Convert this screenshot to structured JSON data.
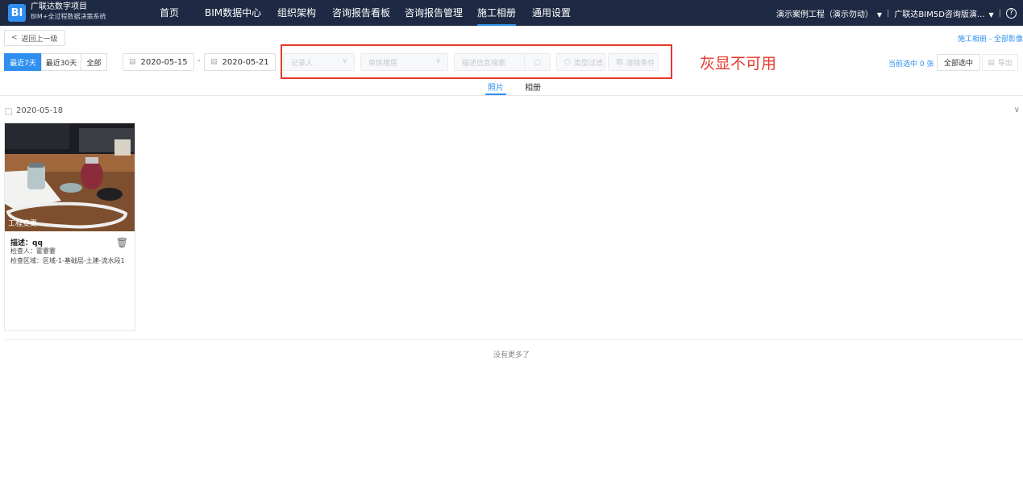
{
  "header": {
    "logo_text": "BI",
    "brand_line1": "广联达数字项目",
    "brand_line2": "BIM+全过程数据决策系统",
    "nav": [
      {
        "label": "首页",
        "active": false
      },
      {
        "label": "BIM数据中心",
        "active": false
      },
      {
        "label": "组织架构",
        "active": false
      },
      {
        "label": "咨询报告看板",
        "active": false
      },
      {
        "label": "咨询报告管理",
        "active": false
      },
      {
        "label": "施工相册",
        "active": true
      },
      {
        "label": "通用设置",
        "active": false
      }
    ],
    "project": "演示案例工程（演示勿动）",
    "org": "广联达BIM5D咨询版演...",
    "help": "?"
  },
  "toolbar": {
    "back_label": "返回上一级",
    "breadcrumb": "施工相册 - 全部影像",
    "ranges": [
      "最近7天",
      "最近30天",
      "全部"
    ],
    "date_start": "2020-05-15",
    "date_sep": "-",
    "date_end": "2020-05-21",
    "recorder_placeholder": "记录人",
    "floor_placeholder": "单体楼层",
    "search_placeholder": "描述信息搜索",
    "type_filter": "类型过滤",
    "clear_filter": "清除条件",
    "annotation": "灰显不可用",
    "selected_info": "当前选中 0 张",
    "select_all": "全部选中",
    "export": "导出"
  },
  "tabs": [
    {
      "label": "照片",
      "active": true
    },
    {
      "label": "相册",
      "active": false
    }
  ],
  "group": {
    "date": "2020-05-18",
    "photo": {
      "tag": "工程变更",
      "desc_label": "描述：",
      "desc_value": "qq",
      "inspector": "检查人：霍霎霎",
      "area": "检查区域：区域-1-基础层-土建-流水段1"
    }
  },
  "footer": {
    "no_more": "没有更多了"
  },
  "colors": {
    "nav_bg": "#1e2a44",
    "accent": "#2f8ff0",
    "annotation_red": "#e5382d"
  }
}
